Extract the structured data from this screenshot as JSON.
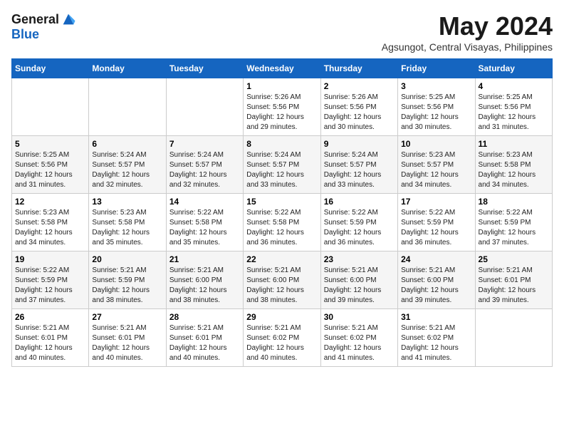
{
  "header": {
    "logo_general": "General",
    "logo_blue": "Blue",
    "month_title": "May 2024",
    "location": "Agsungot, Central Visayas, Philippines"
  },
  "days_of_week": [
    "Sunday",
    "Monday",
    "Tuesday",
    "Wednesday",
    "Thursday",
    "Friday",
    "Saturday"
  ],
  "weeks": [
    [
      {
        "day": "",
        "info": ""
      },
      {
        "day": "",
        "info": ""
      },
      {
        "day": "",
        "info": ""
      },
      {
        "day": "1",
        "info": "Sunrise: 5:26 AM\nSunset: 5:56 PM\nDaylight: 12 hours\nand 29 minutes."
      },
      {
        "day": "2",
        "info": "Sunrise: 5:26 AM\nSunset: 5:56 PM\nDaylight: 12 hours\nand 30 minutes."
      },
      {
        "day": "3",
        "info": "Sunrise: 5:25 AM\nSunset: 5:56 PM\nDaylight: 12 hours\nand 30 minutes."
      },
      {
        "day": "4",
        "info": "Sunrise: 5:25 AM\nSunset: 5:56 PM\nDaylight: 12 hours\nand 31 minutes."
      }
    ],
    [
      {
        "day": "5",
        "info": "Sunrise: 5:25 AM\nSunset: 5:56 PM\nDaylight: 12 hours\nand 31 minutes."
      },
      {
        "day": "6",
        "info": "Sunrise: 5:24 AM\nSunset: 5:57 PM\nDaylight: 12 hours\nand 32 minutes."
      },
      {
        "day": "7",
        "info": "Sunrise: 5:24 AM\nSunset: 5:57 PM\nDaylight: 12 hours\nand 32 minutes."
      },
      {
        "day": "8",
        "info": "Sunrise: 5:24 AM\nSunset: 5:57 PM\nDaylight: 12 hours\nand 33 minutes."
      },
      {
        "day": "9",
        "info": "Sunrise: 5:24 AM\nSunset: 5:57 PM\nDaylight: 12 hours\nand 33 minutes."
      },
      {
        "day": "10",
        "info": "Sunrise: 5:23 AM\nSunset: 5:57 PM\nDaylight: 12 hours\nand 34 minutes."
      },
      {
        "day": "11",
        "info": "Sunrise: 5:23 AM\nSunset: 5:58 PM\nDaylight: 12 hours\nand 34 minutes."
      }
    ],
    [
      {
        "day": "12",
        "info": "Sunrise: 5:23 AM\nSunset: 5:58 PM\nDaylight: 12 hours\nand 34 minutes."
      },
      {
        "day": "13",
        "info": "Sunrise: 5:23 AM\nSunset: 5:58 PM\nDaylight: 12 hours\nand 35 minutes."
      },
      {
        "day": "14",
        "info": "Sunrise: 5:22 AM\nSunset: 5:58 PM\nDaylight: 12 hours\nand 35 minutes."
      },
      {
        "day": "15",
        "info": "Sunrise: 5:22 AM\nSunset: 5:58 PM\nDaylight: 12 hours\nand 36 minutes."
      },
      {
        "day": "16",
        "info": "Sunrise: 5:22 AM\nSunset: 5:59 PM\nDaylight: 12 hours\nand 36 minutes."
      },
      {
        "day": "17",
        "info": "Sunrise: 5:22 AM\nSunset: 5:59 PM\nDaylight: 12 hours\nand 36 minutes."
      },
      {
        "day": "18",
        "info": "Sunrise: 5:22 AM\nSunset: 5:59 PM\nDaylight: 12 hours\nand 37 minutes."
      }
    ],
    [
      {
        "day": "19",
        "info": "Sunrise: 5:22 AM\nSunset: 5:59 PM\nDaylight: 12 hours\nand 37 minutes."
      },
      {
        "day": "20",
        "info": "Sunrise: 5:21 AM\nSunset: 5:59 PM\nDaylight: 12 hours\nand 38 minutes."
      },
      {
        "day": "21",
        "info": "Sunrise: 5:21 AM\nSunset: 6:00 PM\nDaylight: 12 hours\nand 38 minutes."
      },
      {
        "day": "22",
        "info": "Sunrise: 5:21 AM\nSunset: 6:00 PM\nDaylight: 12 hours\nand 38 minutes."
      },
      {
        "day": "23",
        "info": "Sunrise: 5:21 AM\nSunset: 6:00 PM\nDaylight: 12 hours\nand 39 minutes."
      },
      {
        "day": "24",
        "info": "Sunrise: 5:21 AM\nSunset: 6:00 PM\nDaylight: 12 hours\nand 39 minutes."
      },
      {
        "day": "25",
        "info": "Sunrise: 5:21 AM\nSunset: 6:01 PM\nDaylight: 12 hours\nand 39 minutes."
      }
    ],
    [
      {
        "day": "26",
        "info": "Sunrise: 5:21 AM\nSunset: 6:01 PM\nDaylight: 12 hours\nand 40 minutes."
      },
      {
        "day": "27",
        "info": "Sunrise: 5:21 AM\nSunset: 6:01 PM\nDaylight: 12 hours\nand 40 minutes."
      },
      {
        "day": "28",
        "info": "Sunrise: 5:21 AM\nSunset: 6:01 PM\nDaylight: 12 hours\nand 40 minutes."
      },
      {
        "day": "29",
        "info": "Sunrise: 5:21 AM\nSunset: 6:02 PM\nDaylight: 12 hours\nand 40 minutes."
      },
      {
        "day": "30",
        "info": "Sunrise: 5:21 AM\nSunset: 6:02 PM\nDaylight: 12 hours\nand 41 minutes."
      },
      {
        "day": "31",
        "info": "Sunrise: 5:21 AM\nSunset: 6:02 PM\nDaylight: 12 hours\nand 41 minutes."
      },
      {
        "day": "",
        "info": ""
      }
    ]
  ]
}
